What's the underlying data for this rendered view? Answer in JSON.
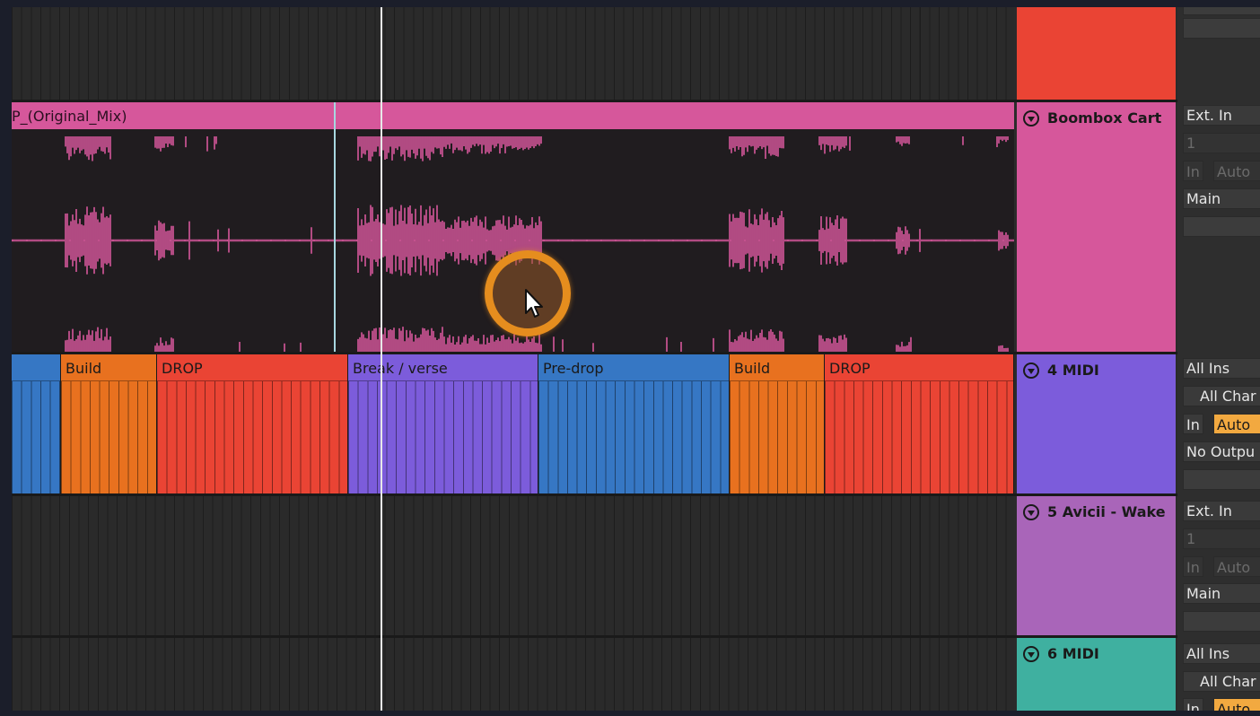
{
  "audio_track": {
    "clip_name": "P_(Original_Mix)",
    "color": "#d6579b",
    "header_name": "Boombox Cart",
    "io": {
      "input_type": "Ext. In",
      "input_channel": "1",
      "monitor_in": "In",
      "monitor_auto": "Auto",
      "output": "Main"
    }
  },
  "arrangement_track": {
    "sections": [
      {
        "label": "",
        "color": "#3677c4",
        "text_color": "#1a1a1a"
      },
      {
        "label": "Build",
        "color": "#e8711f",
        "text_color": "#1a1a1a"
      },
      {
        "label": "DROP",
        "color": "#ea4434",
        "text_color": "#1a1a1a"
      },
      {
        "label": "Break / verse",
        "color": "#7c5cdb",
        "text_color": "#1a1a1a"
      },
      {
        "label": "Pre-drop",
        "color": "#3677c4",
        "text_color": "#1a1a1a"
      },
      {
        "label": "Build",
        "color": "#e8711f",
        "text_color": "#1a1a1a"
      },
      {
        "label": "DROP",
        "color": "#ea4434",
        "text_color": "#1a1a1a"
      }
    ],
    "header_name": "4 MIDI",
    "color": "#7c5cdb",
    "io": {
      "input_type": "All Ins",
      "input_channel": "All Char",
      "monitor_in": "In",
      "monitor_auto": "Auto",
      "output": "No Outpu"
    }
  },
  "track5": {
    "header_name": "5 Avicii - Wake",
    "color": "#a965b9",
    "io": {
      "input_type": "Ext. In",
      "input_channel": "1",
      "monitor_in": "In",
      "monitor_auto": "Auto",
      "output": "Main"
    }
  },
  "track6": {
    "header_name": "6 MIDI",
    "color": "#3fb0a0",
    "io": {
      "input_type": "All Ins",
      "input_channel": "All Char",
      "monitor_in": "In",
      "monitor_auto": "Auto"
    }
  },
  "top_track": {
    "color": "#ea4434"
  },
  "icons": {
    "fold": "fold-triangle-icon",
    "pointer": "mouse-pointer-icon"
  }
}
